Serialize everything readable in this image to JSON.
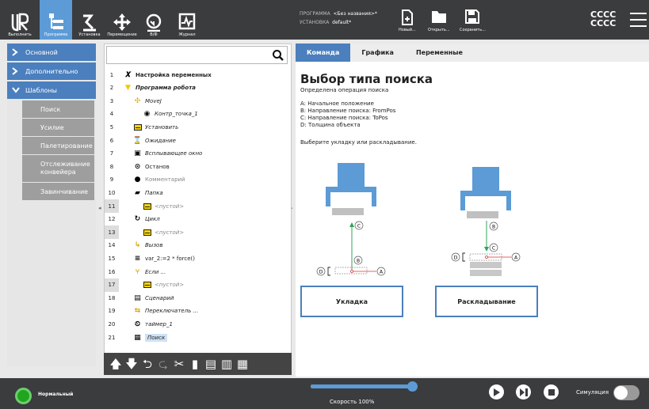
{
  "header": {
    "nav": [
      {
        "label": "Выполнить",
        "icon": "run-icon"
      },
      {
        "label": "Программа",
        "icon": "program-icon"
      },
      {
        "label": "Установка",
        "icon": "installation-icon"
      },
      {
        "label": "Перемещение",
        "icon": "move-icon"
      },
      {
        "label": "В/Ф",
        "icon": "io-icon"
      },
      {
        "label": "Журнал",
        "icon": "log-icon"
      }
    ],
    "program_label": "ПРОГРАММА",
    "program_value": "<Без названия>*",
    "install_label": "УСТАНОВКА",
    "install_value": "default*",
    "file_buttons": [
      {
        "label": "Новый...",
        "icon": "new-file-icon"
      },
      {
        "label": "Открыть...",
        "icon": "open-folder-icon"
      },
      {
        "label": "Сохранить...",
        "icon": "save-icon"
      }
    ],
    "cccc1": "CCCC",
    "cccc2": "CCCC"
  },
  "sidebar": {
    "categories": [
      {
        "label": "Основной",
        "expanded": false
      },
      {
        "label": "Дополнительно",
        "expanded": false
      },
      {
        "label": "Шаблоны",
        "expanded": true
      }
    ],
    "templates": [
      "Поиск",
      "Усилие",
      "Палетирование",
      "Отслеживание конвейера",
      "Завинчивание"
    ]
  },
  "tree": {
    "rows": [
      {
        "n": "1",
        "text": "Настройка переменных",
        "icon": "x-variable-icon"
      },
      {
        "n": "2",
        "text": "Программа робота",
        "icon": "triangle-down-icon"
      },
      {
        "n": "3",
        "text": "MoveJ",
        "icon": "move-joint-icon"
      },
      {
        "n": "4",
        "text": "Контр_точка_1",
        "icon": "waypoint-icon"
      },
      {
        "n": "5",
        "text": "Установить",
        "icon": "set-icon"
      },
      {
        "n": "6",
        "text": "Ожидание",
        "icon": "hourglass-icon"
      },
      {
        "n": "7",
        "text": "Всплывающее окно",
        "icon": "popup-icon"
      },
      {
        "n": "8",
        "text": "Останов",
        "icon": "halt-icon"
      },
      {
        "n": "9",
        "text": "Комментарий",
        "icon": "comment-icon"
      },
      {
        "n": "10",
        "text": "Папка",
        "icon": "folder-icon"
      },
      {
        "n": "11",
        "text": "<пустой>",
        "icon": "empty-icon"
      },
      {
        "n": "12",
        "text": "Цикл",
        "icon": "loop-icon"
      },
      {
        "n": "13",
        "text": "<пустой>",
        "icon": "empty-icon"
      },
      {
        "n": "14",
        "text": "Вызов",
        "icon": "call-icon"
      },
      {
        "n": "15",
        "text": "var_2:=2 * force()",
        "icon": "assignment-icon"
      },
      {
        "n": "16",
        "text": "Если ...",
        "icon": "if-icon"
      },
      {
        "n": "17",
        "text": "<пустой>",
        "icon": "empty-icon"
      },
      {
        "n": "18",
        "text": "Сценарий",
        "icon": "script-icon"
      },
      {
        "n": "19",
        "text": "Переключатель ...",
        "icon": "switch-icon"
      },
      {
        "n": "20",
        "text": "таймер_1",
        "icon": "timer-icon"
      },
      {
        "n": "21",
        "text": "Поиск",
        "icon": "search-node-icon"
      }
    ]
  },
  "right": {
    "tabs": [
      "Команда",
      "Графика",
      "Переменные"
    ],
    "title": "Выбор типа поиска",
    "subtitle": "Определена операция поиска",
    "info": [
      "A: Начальное положение",
      "B: Направление поиска: FromPos",
      "C: Направление поиска: ToPos",
      "D: Толщина объекта"
    ],
    "choose": "Выберите укладку или раскладывание.",
    "btn_stack": "Укладка",
    "btn_destack": "Раскладывание",
    "labels": {
      "a": "A",
      "b": "B",
      "c": "C",
      "d": "D"
    }
  },
  "footer": {
    "status": "Нормальный",
    "speed": "Скорость 100%",
    "speed_fraction": 1.0,
    "simulation": "Симуляция"
  },
  "colors": {
    "accent": "#4b7fbe",
    "header": "#3b3c3e",
    "ok": "#1fa51f"
  }
}
